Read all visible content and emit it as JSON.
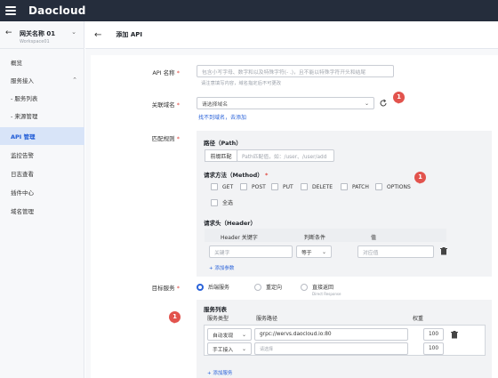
{
  "topbar": {
    "brand": "Daocloud"
  },
  "sidebar": {
    "workspace_name": "网关名称 01",
    "workspace_sub": "Workspace01",
    "items": [
      {
        "label": "概览"
      },
      {
        "label": "服务接入"
      },
      {
        "label": "- 服务列表"
      },
      {
        "label": "- 来源管理"
      },
      {
        "label": "API 管理"
      },
      {
        "label": "监控告警"
      },
      {
        "label": "日志查看"
      },
      {
        "label": "插件中心"
      },
      {
        "label": "域名管理"
      }
    ]
  },
  "header": {
    "title": "添加 API"
  },
  "form": {
    "api_name": {
      "label": "API 名称",
      "placeholder": "包含小写字母、数字和以及特殊字符(- .)，且不能以特殊字符开头和结尾",
      "hint": "请注意填写内容，域名指定后不可更改"
    },
    "domain": {
      "label": "关联域名",
      "placeholder": "请选择域名",
      "link": "找不到域名，去添加"
    },
    "match": {
      "label": "匹配规则",
      "path_title": "路径（Path）",
      "path_prefix": "前缀匹配",
      "path_placeholder": "Path匹配值，如：/user、/user/add",
      "method_title": "请求方法（Method）",
      "methods": [
        "GET",
        "POST",
        "PUT",
        "DELETE",
        "PATCH",
        "OPTIONS"
      ],
      "select_all": "全选",
      "header_title": "请求头（Header）",
      "header_cols": [
        "Header 关键字",
        "判断条件",
        "值"
      ],
      "header_key_placeholder": "关键字",
      "header_condition": "等于",
      "header_value_placeholder": "对应值",
      "add_param": "+ 添加参数"
    },
    "target": {
      "label": "目标服务",
      "options": [
        "后端服务",
        "重定向",
        "直接返回"
      ],
      "option_sub": "Direct Response",
      "list_title": "服务列表",
      "cols": [
        "服务类型",
        "服务路径",
        "权重"
      ],
      "rows": [
        {
          "type": "自动发现",
          "path": "grpc://wervs.daocloud.io:80",
          "weight": "100"
        },
        {
          "type": "手工接入",
          "path": "",
          "path_placeholder": "请选择",
          "weight": "100"
        }
      ],
      "add_service": "+ 添加服务"
    },
    "badges": [
      "1",
      "1",
      "1"
    ]
  }
}
